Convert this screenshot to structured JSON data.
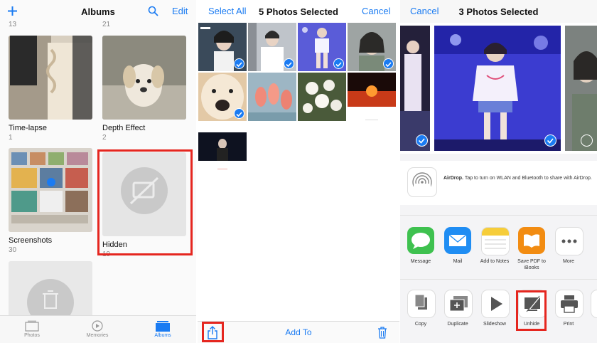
{
  "albums_screen": {
    "title": "Albums",
    "edit_label": "Edit",
    "top_counts": [
      "13",
      "21"
    ],
    "albums": [
      {
        "name": "Time-lapse",
        "count": "1"
      },
      {
        "name": "Depth Effect",
        "count": "2"
      },
      {
        "name": "Screenshots",
        "count": "30"
      },
      {
        "name": "Hidden",
        "count": "19"
      }
    ],
    "tabs": [
      {
        "label": "Photos",
        "active": false
      },
      {
        "label": "Memories",
        "active": false
      },
      {
        "label": "Albums",
        "active": true
      }
    ]
  },
  "select_screen": {
    "select_all_label": "Select All",
    "title": "5 Photos Selected",
    "cancel_label": "Cancel",
    "add_to_label": "Add To"
  },
  "share_screen": {
    "cancel_label": "Cancel",
    "title": "3 Photos Selected",
    "airdrop_title": "AirDrop.",
    "airdrop_text": " Tap to turn on WLAN and Bluetooth to share with AirDrop.",
    "apps": [
      {
        "label": "Message",
        "icon": "message-icon"
      },
      {
        "label": "Mail",
        "icon": "mail-icon"
      },
      {
        "label": "Add to Notes",
        "icon": "notes-icon"
      },
      {
        "label": "Save PDF to iBooks",
        "icon": "ibooks-icon"
      },
      {
        "label": "More",
        "icon": "more-icon"
      }
    ],
    "actions": [
      {
        "label": "Copy",
        "icon": "copy-icon"
      },
      {
        "label": "Duplicate",
        "icon": "duplicate-icon"
      },
      {
        "label": "Slideshow",
        "icon": "play-icon"
      },
      {
        "label": "Unhide",
        "icon": "unhide-icon"
      },
      {
        "label": "Print",
        "icon": "print-icon"
      }
    ]
  },
  "colors": {
    "accent": "#1a7bf2",
    "highlight": "#e5261f"
  }
}
